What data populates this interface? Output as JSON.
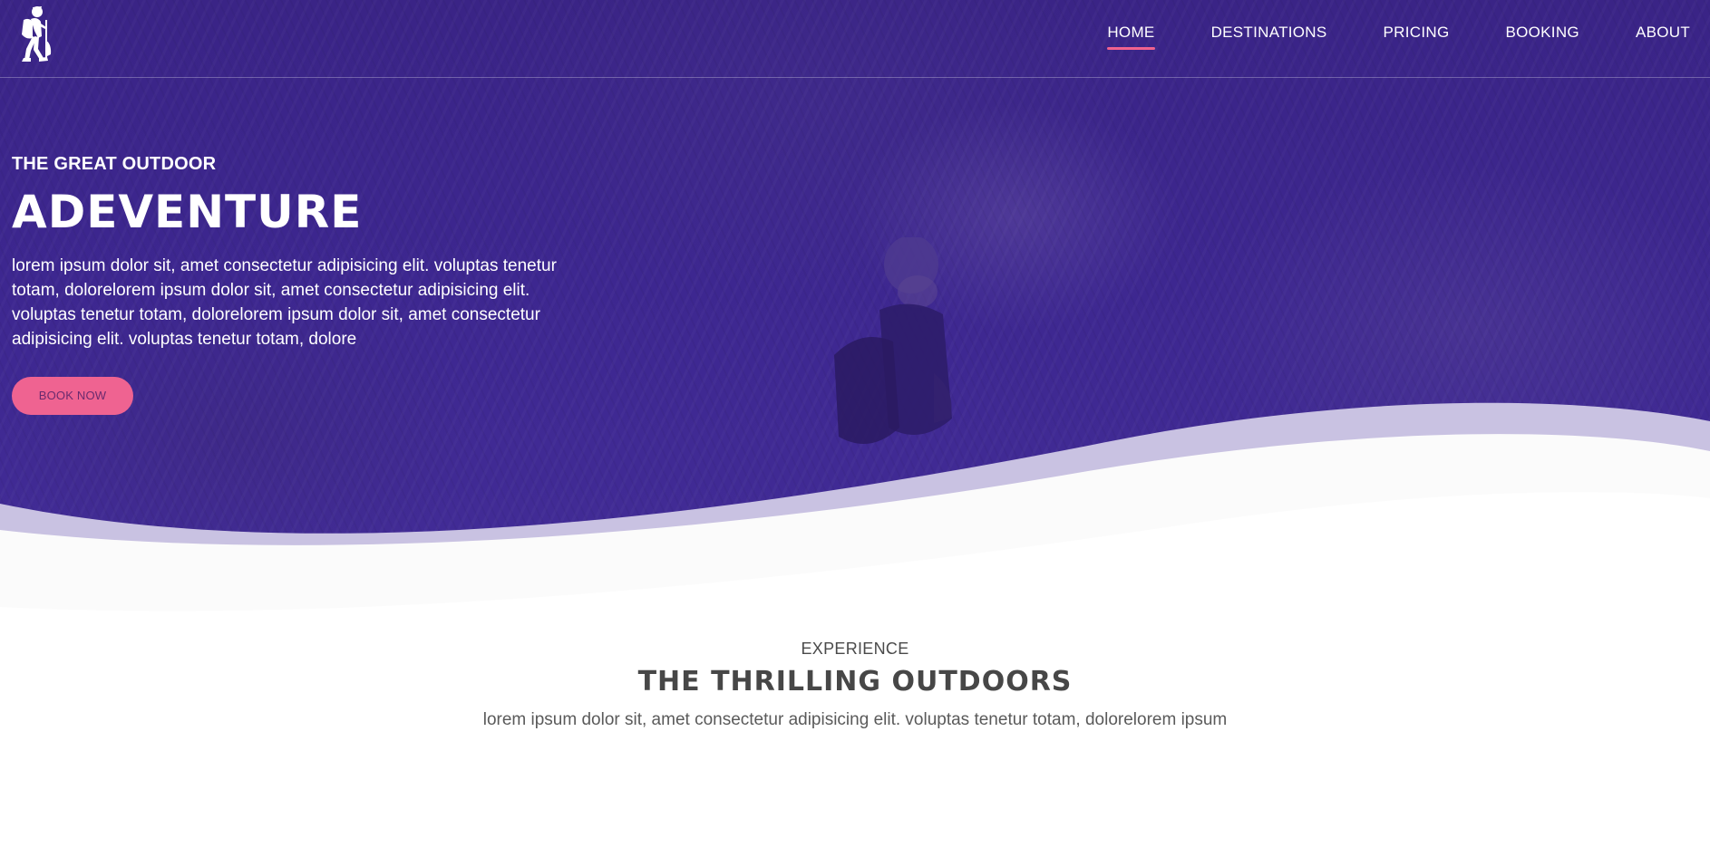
{
  "nav": {
    "logo_icon": "hiker-icon",
    "items": [
      {
        "label": "HOME",
        "active": true
      },
      {
        "label": "DESTINATIONS",
        "active": false
      },
      {
        "label": "PRICING",
        "active": false
      },
      {
        "label": "BOOKING",
        "active": false
      },
      {
        "label": "ABOUT",
        "active": false
      }
    ],
    "active_indicator_color": "#f0628e"
  },
  "hero": {
    "eyebrow": "THE GREAT OUTDOOR",
    "title": "ADEVENTURE",
    "description": "lorem ipsum dolor sit, amet consectetur adipisicing elit. voluptas tenetur totam, dolorelorem ipsum dolor sit, amet consectetur adipisicing elit. voluptas tenetur totam, dolorelorem ipsum dolor sit, amet consectetur adipisicing elit. voluptas tenetur totam, dolore",
    "cta_label": "BOOK NOW",
    "overlay_color": "#3d2790",
    "cta_color": "#ef6391"
  },
  "experience": {
    "eyebrow": "EXPERIENCE",
    "title": "THE THRILLING OUTDOORS",
    "description": "lorem ipsum dolor sit, amet consectetur adipisicing elit. voluptas tenetur totam, dolorelorem ipsum"
  }
}
